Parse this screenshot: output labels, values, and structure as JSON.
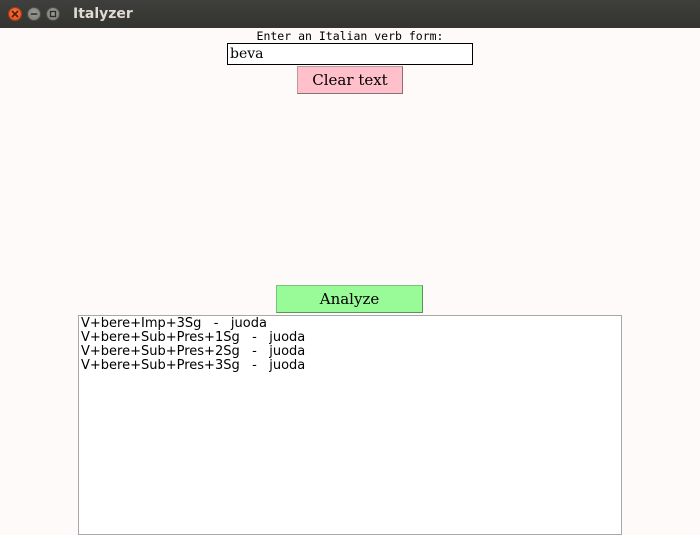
{
  "window": {
    "title": "Italyzer"
  },
  "icons": {
    "close": "close-icon",
    "minimize": "minimize-icon",
    "maximize": "maximize-icon"
  },
  "colors": {
    "titlebar": "#3c3b37",
    "close_button": "#df4b16",
    "clear_button": "#ffc0cb",
    "analyze_button": "#98fb98",
    "background": "#fffafa"
  },
  "form": {
    "prompt": "Enter an Italian verb form:",
    "input_value": "beva",
    "clear_label": "Clear text",
    "analyze_label": "Analyze"
  },
  "results": [
    "V+bere+Imp+3Sg   -   juoda",
    "V+bere+Sub+Pres+1Sg   -   juoda",
    "V+bere+Sub+Pres+2Sg   -   juoda",
    "V+bere+Sub+Pres+3Sg   -   juoda"
  ]
}
